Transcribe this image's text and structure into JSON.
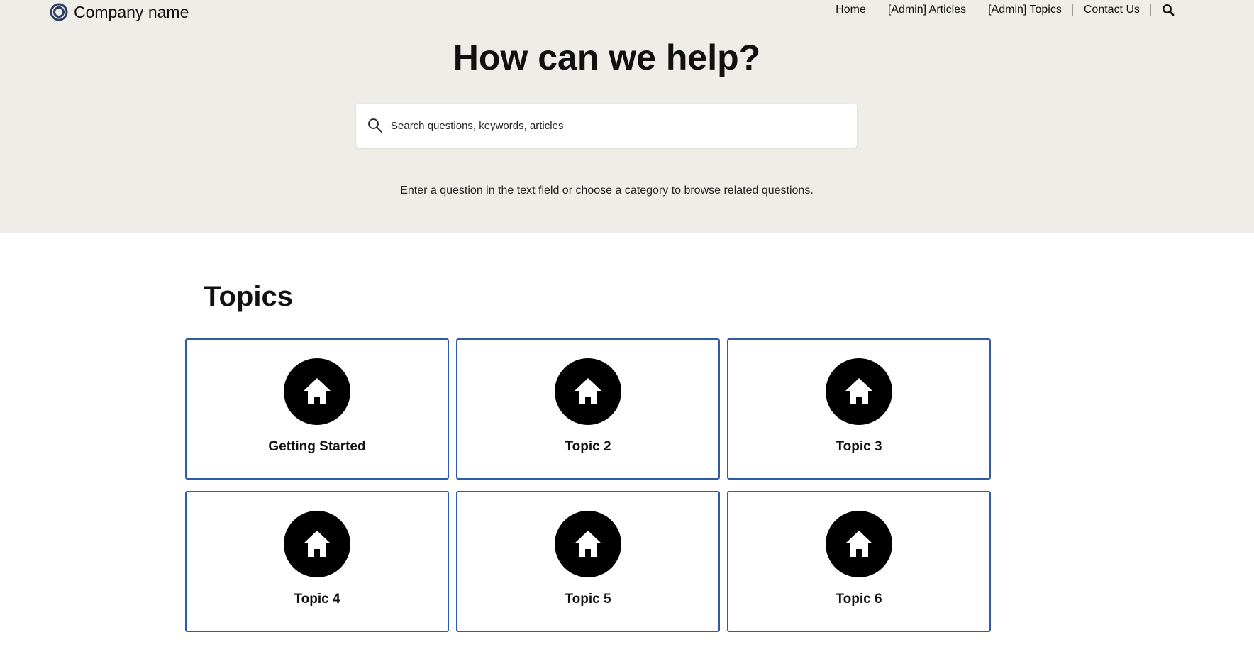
{
  "header": {
    "brand": {
      "logo_icon": "ring-logo-icon",
      "name": "Company name",
      "logo_color": "#2f3e66"
    },
    "nav": [
      {
        "label": "Home"
      },
      {
        "label": "[Admin] Articles"
      },
      {
        "label": "[Admin] Topics"
      },
      {
        "label": "Contact Us"
      }
    ],
    "search_icon": "search-icon"
  },
  "hero": {
    "title": "How can we help?",
    "search": {
      "icon": "search-icon",
      "placeholder": "Search questions, keywords, articles",
      "value": ""
    },
    "hint": "Enter a question in the text field or choose a category to browse related questions.",
    "background": "#eeede8"
  },
  "topics": {
    "title": "Topics",
    "card_border_color": "#2f5aa5",
    "items": [
      {
        "label": "Getting Started",
        "icon": "home-icon"
      },
      {
        "label": "Topic 2",
        "icon": "home-icon"
      },
      {
        "label": "Topic 3",
        "icon": "home-icon"
      },
      {
        "label": "Topic 4",
        "icon": "home-icon"
      },
      {
        "label": "Topic 5",
        "icon": "home-icon"
      },
      {
        "label": "Topic 6",
        "icon": "home-icon"
      }
    ]
  }
}
